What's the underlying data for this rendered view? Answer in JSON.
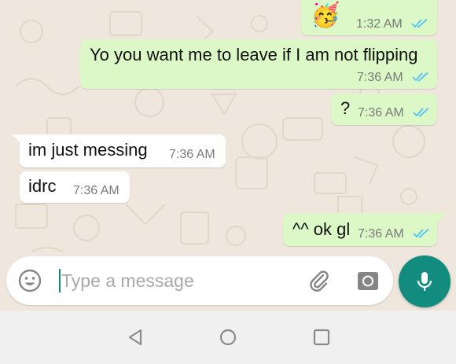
{
  "messages": [
    {
      "direction": "outgoing",
      "content_type": "emoji-sticker",
      "emoji": "🥳",
      "time": "1:32 AM",
      "status": "read"
    },
    {
      "direction": "outgoing",
      "text": "Yo you want me to leave if I am not flipping",
      "time": "7:36 AM",
      "status": "read"
    },
    {
      "direction": "outgoing",
      "text": "?",
      "time": "7:36 AM",
      "status": "read"
    },
    {
      "direction": "incoming",
      "text": "im just messing",
      "time": "7:36 AM"
    },
    {
      "direction": "incoming",
      "text": "idrc",
      "time": "7:36 AM"
    },
    {
      "direction": "outgoing",
      "text": "^^ ok gl",
      "time": "7:36 AM",
      "status": "read"
    }
  ],
  "composer": {
    "placeholder": "Type a message",
    "value": ""
  },
  "icons": {
    "emoji": "emoji-smiley-icon",
    "attach": "paperclip-icon",
    "camera": "camera-icon",
    "mic": "microphone-icon",
    "read_receipt": "double-check-icon",
    "nav_back": "triangle-back-icon",
    "nav_home": "circle-home-icon",
    "nav_recents": "square-recents-icon"
  },
  "colors": {
    "outgoing_bubble": "#dcf8c6",
    "incoming_bubble": "#ffffff",
    "wallpaper": "#efe7dd",
    "accent": "#128c7e",
    "read_tick": "#4fc3f7"
  }
}
